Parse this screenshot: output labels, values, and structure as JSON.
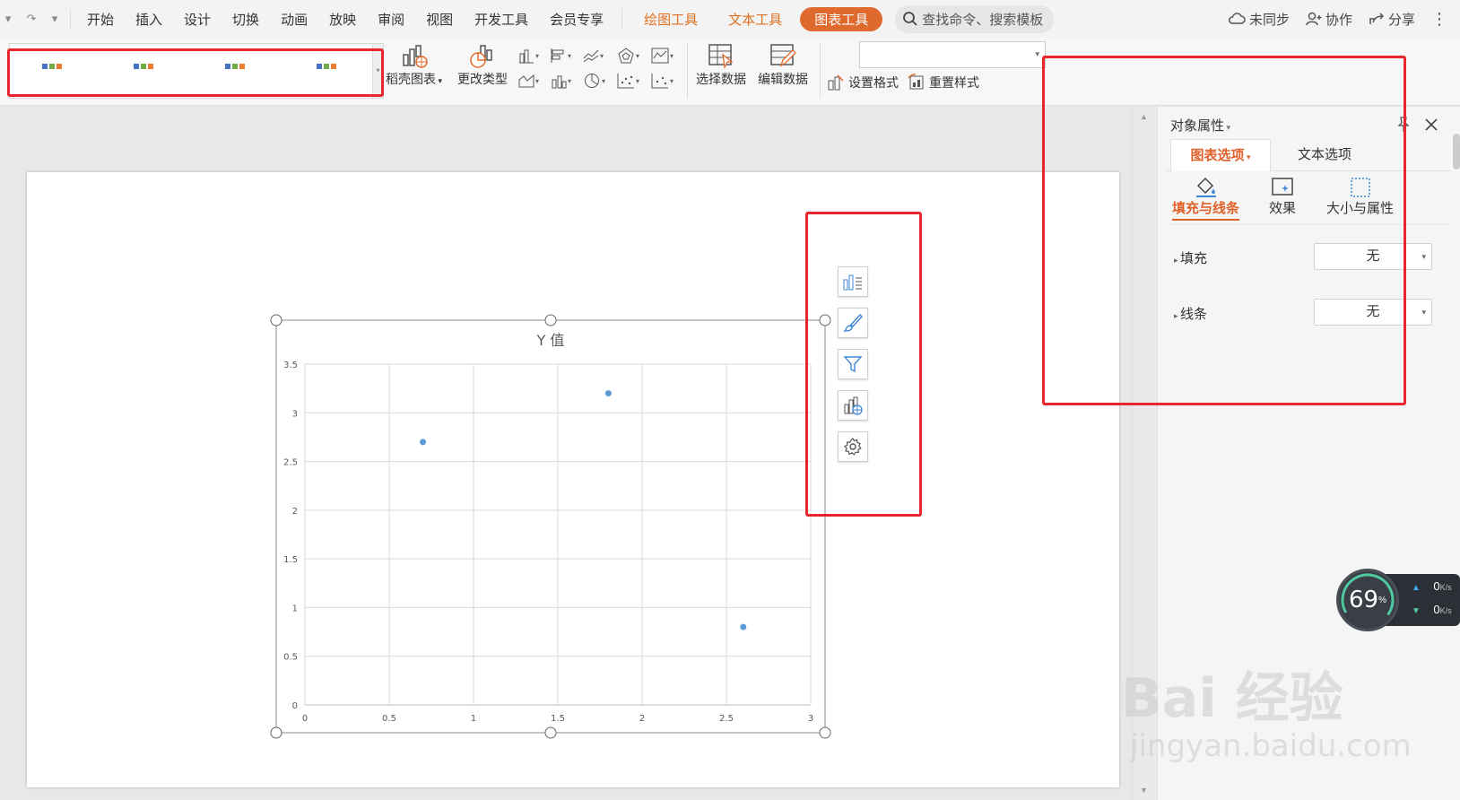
{
  "menubar": {
    "undo_glyph": "⌃",
    "redo_glyph": "↷",
    "more_glyph": "▾",
    "tabs": [
      "开始",
      "插入",
      "设计",
      "切换",
      "动画",
      "放映",
      "审阅",
      "视图",
      "开发工具",
      "会员专享"
    ],
    "context_tabs": [
      "绘图工具",
      "文本工具"
    ],
    "active_tab": "图表工具",
    "search_placeholder": "查找命令、搜索模板",
    "sync": "未同步",
    "collab": "协作",
    "share": "分享",
    "menu_glyph": "⋮"
  },
  "ribbon": {
    "buttons": {
      "shell_chart": "稻壳图表",
      "change_type": "更改类型",
      "select_data": "选择数据",
      "edit_data": "编辑数据",
      "set_format": "设置格式",
      "reset_style": "重置样式"
    },
    "style_thumbs": 4,
    "combo_value": ""
  },
  "chart": {
    "title": "Y 值"
  },
  "chart_data": {
    "type": "scatter",
    "title": "Y 值",
    "xlabel": "",
    "ylabel": "",
    "x": [
      0.7,
      1.8,
      2.6
    ],
    "y": [
      2.7,
      3.2,
      0.8
    ],
    "xlim": [
      0,
      3
    ],
    "ylim": [
      0,
      3.5
    ],
    "xticks": [
      "0",
      "0.5",
      "1",
      "1.5",
      "2",
      "2.5",
      "3"
    ],
    "yticks": [
      "0",
      "0.5",
      "1",
      "1.5",
      "2",
      "2.5",
      "3",
      "3.5"
    ],
    "grid": true,
    "color": "#5b9bd5"
  },
  "pane": {
    "title": "对象属性",
    "tab_chart": "图表选项",
    "tab_text": "文本选项",
    "sub_fill": "填充与线条",
    "sub_effect": "效果",
    "sub_size": "大小与属性",
    "fill_label": "填充",
    "fill_value": "无",
    "line_label": "线条",
    "line_value": "无"
  },
  "speed": {
    "percent": "69",
    "percent_unit": "%",
    "up": "0",
    "down": "0",
    "unit": "K/s"
  },
  "watermark": {
    "text": "Bai 经验",
    "url": "jingyan.baidu.com"
  },
  "colors": {
    "accent": "#e06a2e",
    "highlight": "#e8262b",
    "series": "#5b9bd5"
  }
}
